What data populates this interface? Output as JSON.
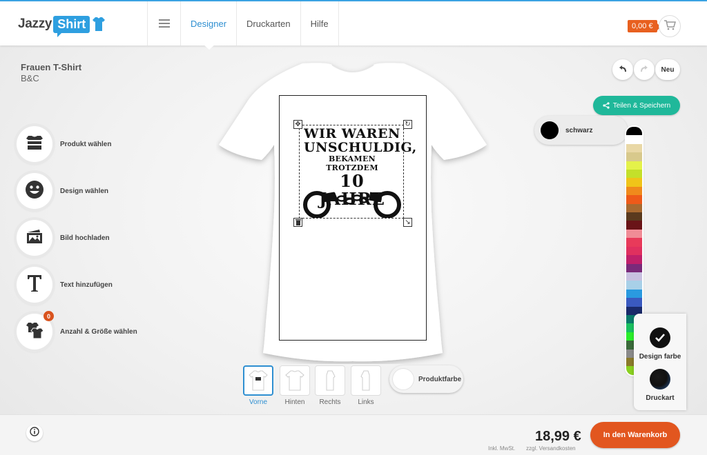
{
  "header": {
    "logo_jazzy": "Jazzy",
    "logo_shirt": "Shirt",
    "nav": [
      {
        "label": "Designer",
        "active": true
      },
      {
        "label": "Druckarten",
        "active": false
      },
      {
        "label": "Hilfe",
        "active": false
      }
    ],
    "cart_total": "0,00 €",
    "accent_color": "#2e8fd1"
  },
  "product": {
    "name": "Frauen T-Shirt",
    "brand": "B&C"
  },
  "tools": [
    {
      "label": "Produkt wählen",
      "icon": "stack-icon"
    },
    {
      "label": "Design wählen",
      "icon": "smiley-icon"
    },
    {
      "label": "Bild hochladen",
      "icon": "image-upload-icon"
    },
    {
      "label": "Text hinzufügen",
      "icon": "text-t-icon"
    },
    {
      "label": "Anzahl & Größe wählen",
      "icon": "shirts-icon",
      "badge": "0"
    }
  ],
  "design": {
    "line1": "WIR WAREN",
    "line2": "UNSCHULDIG,",
    "line3": "BEKAMEN TROTZDEM",
    "line4": "10 JAHRE"
  },
  "views": [
    {
      "label": "Vorne",
      "active": true
    },
    {
      "label": "Hinten",
      "active": false
    },
    {
      "label": "Rechts",
      "active": false
    },
    {
      "label": "Links",
      "active": false
    }
  ],
  "product_color_label": "Produktfarbe",
  "actions": {
    "new_label": "Neu",
    "share_label": "Teilen & Speichern"
  },
  "selected_color": {
    "name": "schwarz",
    "hex": "#000000"
  },
  "palette": [
    "#000000",
    "#ffffff",
    "#e9d8a6",
    "#d8c98c",
    "#e4f24a",
    "#c4e02a",
    "#f0c419",
    "#f08a1c",
    "#ee5a19",
    "#a86a30",
    "#5a3a1e",
    "#6a1418",
    "#f08c96",
    "#e83a5a",
    "#e0305f",
    "#c0206a",
    "#7a2a7a",
    "#c8c0e0",
    "#a8d0e8",
    "#2a9ae0",
    "#3a5ac0",
    "#1a2a6a",
    "#0a7a6a",
    "#1ac060",
    "#2aee2a",
    "#3a6a3a",
    "#8a8a8a",
    "#8a7a2a",
    "#8ad020"
  ],
  "side_panel": {
    "design_color_label": "Design farbe",
    "print_type_label": "Druckart"
  },
  "footer": {
    "total": "18,99 €",
    "tax_note": "Inkl. MwSt.",
    "shipping_note": "zzgl. Versandkosten",
    "buy_label": "In den Warenkorb",
    "buy_color": "#e2561f"
  }
}
